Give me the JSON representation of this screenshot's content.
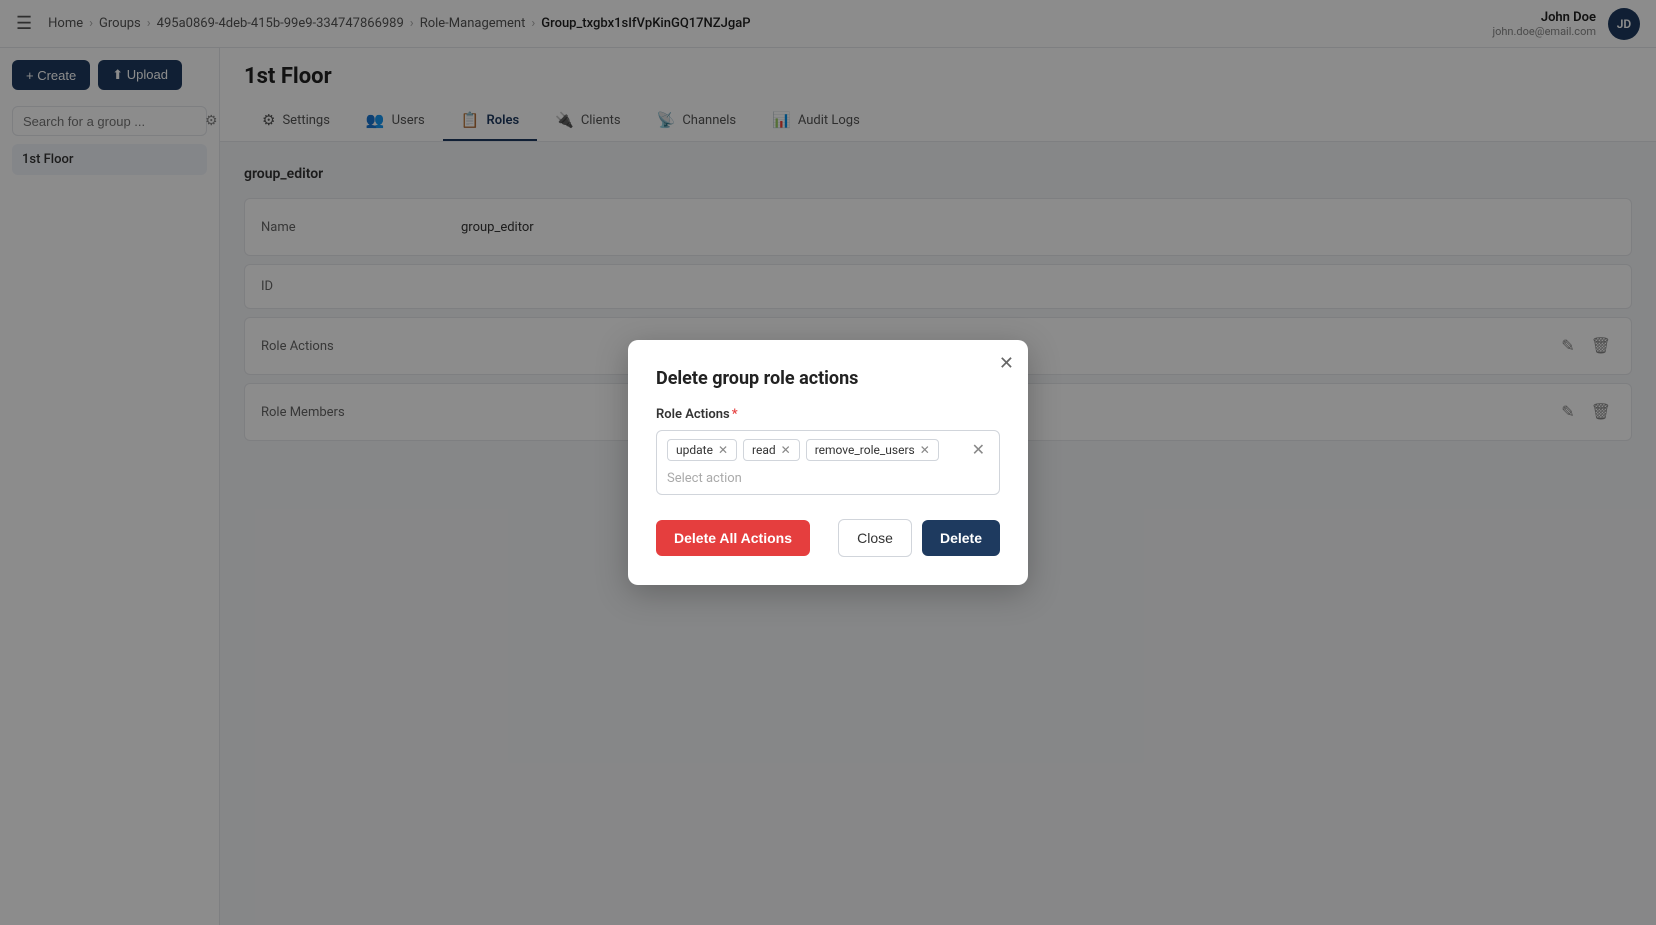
{
  "topbar": {
    "menu_icon": "☰",
    "breadcrumbs": [
      {
        "label": "Home",
        "active": false
      },
      {
        "label": "Groups",
        "active": false
      },
      {
        "label": "495a0869-4deb-415b-99e9-334747866989",
        "active": false
      },
      {
        "label": "Role-Management",
        "active": false
      },
      {
        "label": "Group_txgbx1sIfVpKinGQ17NZJgaP",
        "active": true
      }
    ],
    "user": {
      "name": "John Doe",
      "email": "john.doe@email.com",
      "initials": "JD"
    }
  },
  "sidebar": {
    "create_label": "+ Create",
    "upload_label": "⬆ Upload",
    "search_placeholder": "Search for a group ...",
    "filter_icon": "⚙",
    "group_item": "1st Floor"
  },
  "content": {
    "title": "1st Floor",
    "tabs": [
      {
        "label": "Settings",
        "icon": "⚙",
        "active": false
      },
      {
        "label": "Users",
        "icon": "👥",
        "active": false
      },
      {
        "label": "Roles",
        "icon": "📋",
        "active": false
      },
      {
        "label": "Clients",
        "icon": "🔌",
        "active": false
      },
      {
        "label": "Channels",
        "icon": "📡",
        "active": false
      },
      {
        "label": "Audit Logs",
        "icon": "📊",
        "active": false
      }
    ],
    "role_section": "group_editor",
    "rows": [
      {
        "label": "Name",
        "value": "group_editor",
        "has_edit": false,
        "has_delete": false
      },
      {
        "label": "ID",
        "value": "",
        "has_edit": false,
        "has_delete": false
      },
      {
        "label": "Role Actions",
        "value": "",
        "has_edit": true,
        "has_delete": true
      },
      {
        "label": "Role Members",
        "value": "",
        "has_edit": true,
        "has_delete": true
      }
    ]
  },
  "modal": {
    "title": "Delete group role actions",
    "field_label": "Role Actions",
    "required": true,
    "tags": [
      {
        "label": "update"
      },
      {
        "label": "read"
      },
      {
        "label": "remove_role_users"
      }
    ],
    "select_placeholder": "Select action",
    "btn_delete_all": "Delete All Actions",
    "btn_close": "Close",
    "btn_delete": "Delete"
  }
}
